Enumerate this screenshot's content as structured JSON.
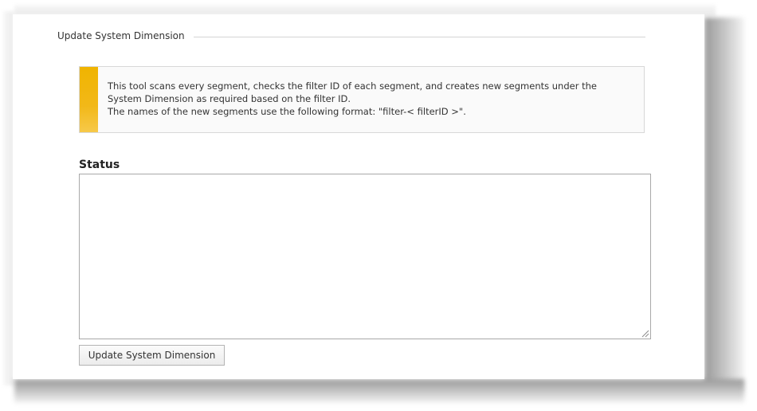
{
  "fieldset": {
    "legend": "Update System Dimension"
  },
  "info": {
    "lines": [
      "This tool scans every segment, checks the filter ID of each segment, and creates new segments under the",
      "System Dimension as required based on the filter ID.",
      "The names of the new segments use the following format: \"filter-< filterID >\"."
    ],
    "accent_color": "#f0b400"
  },
  "status": {
    "label": "Status",
    "value": ""
  },
  "actions": {
    "update_label": "Update System Dimension"
  }
}
